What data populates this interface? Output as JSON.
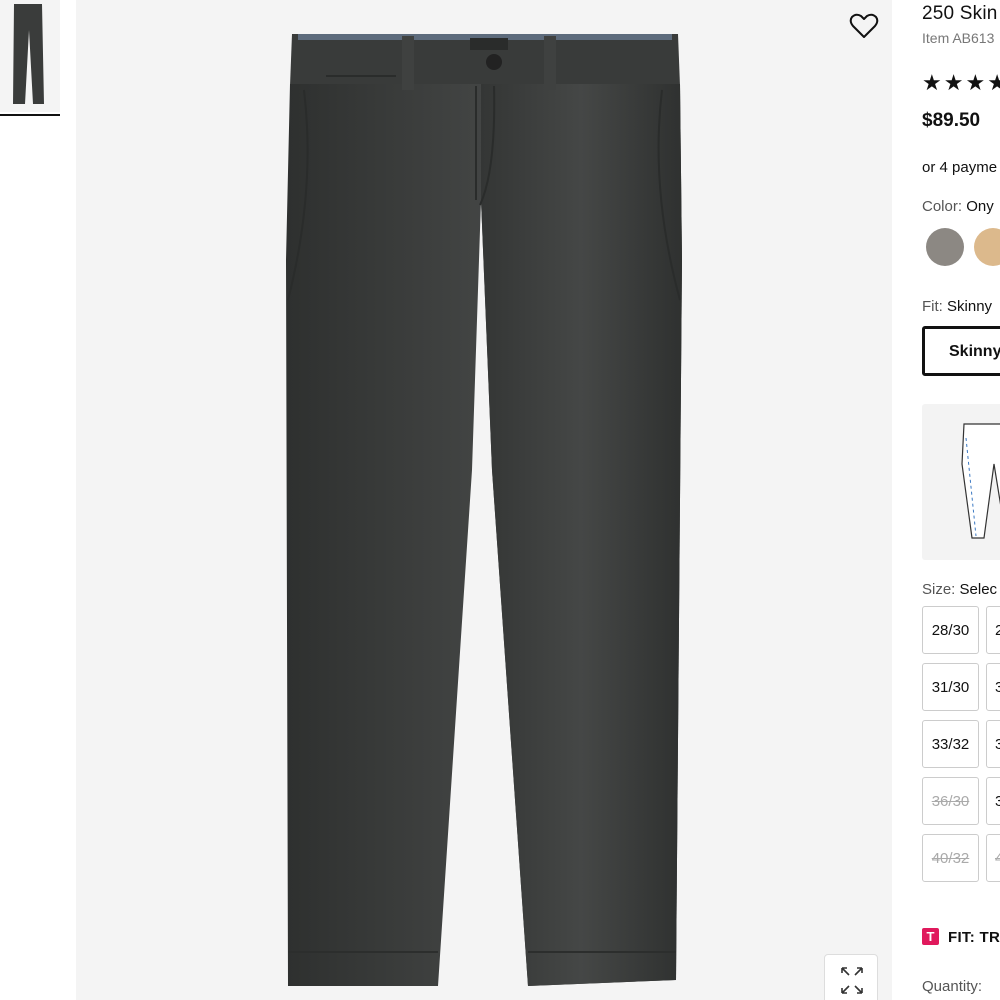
{
  "product": {
    "title": "250 Skin",
    "item_number": "Item AB613",
    "rating_stars": 4,
    "price": "$89.50",
    "payments_text": "or 4 payme"
  },
  "color": {
    "label": "Color:",
    "value": "Ony",
    "swatches": [
      {
        "name": "gray-swatch",
        "hex": "#8c8883"
      },
      {
        "name": "khaki-swatch",
        "hex": "#dcb98c"
      }
    ]
  },
  "fit": {
    "label": "Fit:",
    "value": "Skinny",
    "selected_button": "Skinny"
  },
  "size": {
    "label": "Size:",
    "value": "Selec",
    "rows": [
      {
        "a": "28/30",
        "b": "2",
        "a_disabled": false,
        "b_disabled": false
      },
      {
        "a": "31/30",
        "b": "3",
        "a_disabled": false,
        "b_disabled": false
      },
      {
        "a": "33/32",
        "b": "3",
        "a_disabled": false,
        "b_disabled": false
      },
      {
        "a": "36/30",
        "b": "3",
        "a_disabled": true,
        "b_disabled": false
      },
      {
        "a": "40/32",
        "b": "4",
        "a_disabled": true,
        "b_disabled": true
      }
    ]
  },
  "fit_note": {
    "badge": "T",
    "text": "FIT: TRU"
  },
  "quantity": {
    "label": "Quantity:"
  },
  "icons": {
    "favorite": "heart-icon",
    "zoom": "expand-icon"
  },
  "colors": {
    "pants": "#3a3c3b",
    "background": "#f4f4f4",
    "accent_badge": "#e0195c"
  }
}
